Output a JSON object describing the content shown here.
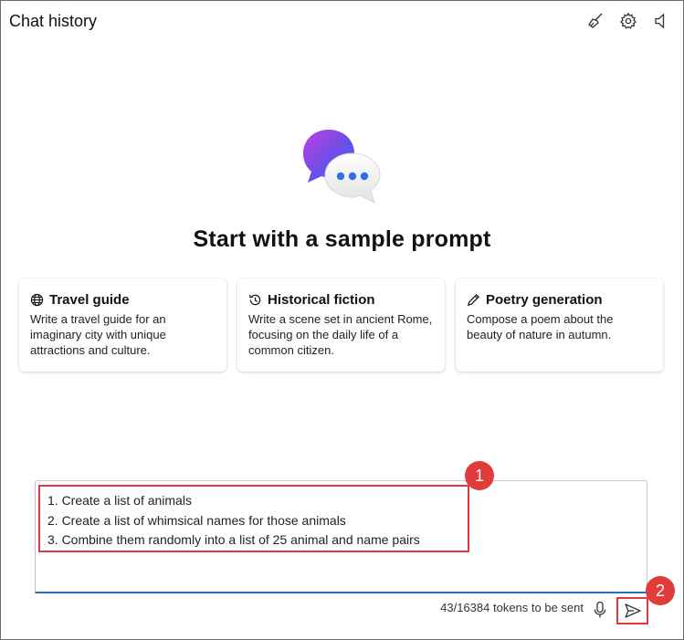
{
  "header": {
    "title": "Chat history"
  },
  "toolbar": {
    "icons": [
      "broom-icon",
      "gear-icon",
      "speaker-icon"
    ]
  },
  "hero": {
    "title": "Start with a sample prompt"
  },
  "cards": [
    {
      "icon": "globe-icon",
      "title": "Travel guide",
      "description": "Write a travel guide for an imaginary city with unique attractions and culture."
    },
    {
      "icon": "history-icon",
      "title": "Historical fiction",
      "description": "Write a scene set in ancient Rome, focusing on the daily life of a common citizen."
    },
    {
      "icon": "pen-icon",
      "title": "Poetry generation",
      "description": "Compose a poem about the beauty of nature in autumn."
    }
  ],
  "prompt": {
    "lines": [
      "1. Create a list of animals",
      "2. Create a list of whimsical names for those animals",
      "3. Combine them randomly into a list of 25 animal and name pairs"
    ]
  },
  "footer": {
    "token_status": "43/16384 tokens to be sent"
  },
  "callouts": [
    "1",
    "2"
  ],
  "colors": {
    "accent": "#2b6cb8",
    "callout": "#e23b3b"
  }
}
